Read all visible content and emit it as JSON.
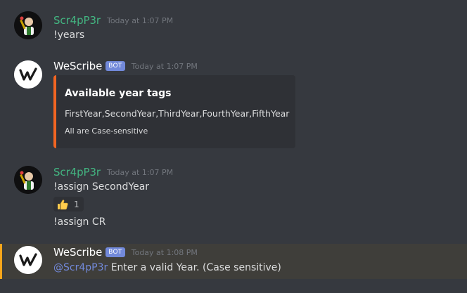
{
  "colors": {
    "background": "#36393f",
    "user_name": "#43b581",
    "bot_name": "#ffffff",
    "bot_tag": "#7289da",
    "embed_bar": "#f26522",
    "mention": "#7289da",
    "highlight_bar": "#faa61a"
  },
  "messages": [
    {
      "author": "Scr4pP3r",
      "timestamp": "Today at 1:07 PM",
      "text": "!years"
    },
    {
      "author": "WeScribe",
      "bot_tag": "BOT",
      "timestamp": "Today at 1:07 PM",
      "embed": {
        "title": "Available year tags",
        "description": "FirstYear,SecondYear,ThirdYear,FourthYear,FifthYear",
        "footer": "All are Case-sensitive"
      }
    },
    {
      "author": "Scr4pP3r",
      "timestamp": "Today at 1:07 PM",
      "text": "!assign SecondYear",
      "reaction": {
        "emoji": "thumbs-up-icon",
        "count": "1"
      },
      "followup_text": "!assign CR"
    },
    {
      "author": "WeScribe",
      "bot_tag": "BOT",
      "timestamp": "Today at 1:08 PM",
      "mention": "@Scr4pP3r",
      "text": " Enter a valid Year. (Case sensitive)"
    }
  ]
}
